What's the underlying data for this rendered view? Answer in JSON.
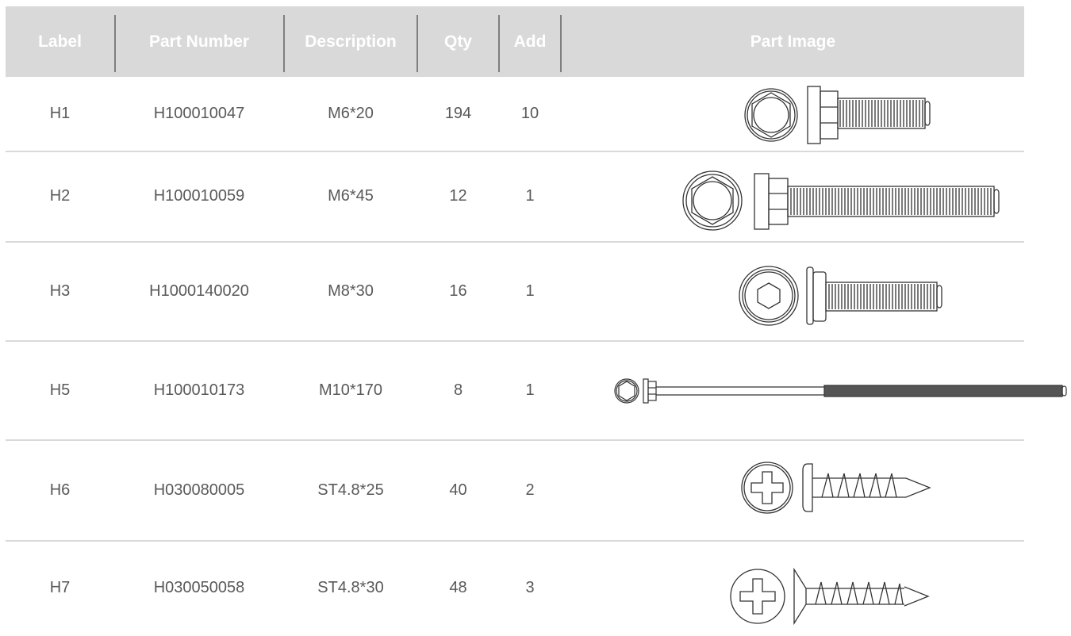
{
  "columns": {
    "label": "Label",
    "part_number": "Part Number",
    "description": "Description",
    "qty": "Qty",
    "add": "Add",
    "part_image": "Part Image"
  },
  "rows": [
    {
      "label": "H1",
      "part_number": "H100010047",
      "description": "M6*20",
      "qty": "194",
      "add": "10",
      "image": "hex-flange-bolt-icon"
    },
    {
      "label": "H2",
      "part_number": "H100010059",
      "description": "M6*45",
      "qty": "12",
      "add": "1",
      "image": "hex-flange-bolt-long-icon"
    },
    {
      "label": "H3",
      "part_number": "H1000140020",
      "description": "M8*30",
      "qty": "16",
      "add": "1",
      "image": "socket-head-bolt-icon"
    },
    {
      "label": "H5",
      "part_number": "H100010173",
      "description": "M10*170",
      "qty": "8",
      "add": "1",
      "image": "long-hex-bolt-icon"
    },
    {
      "label": "H6",
      "part_number": "H030080005",
      "description": "ST4.8*25",
      "qty": "40",
      "add": "2",
      "image": "phillips-pan-screw-icon"
    },
    {
      "label": "H7",
      "part_number": "H030050058",
      "description": "ST4.8*30",
      "qty": "48",
      "add": "3",
      "image": "phillips-countersunk-screw-icon"
    }
  ],
  "colors": {
    "header_bg": "#d9d9d9",
    "header_text": "#ffffff",
    "body_text": "#595959",
    "line": "#d9d9d9",
    "drawing": "#333333"
  }
}
